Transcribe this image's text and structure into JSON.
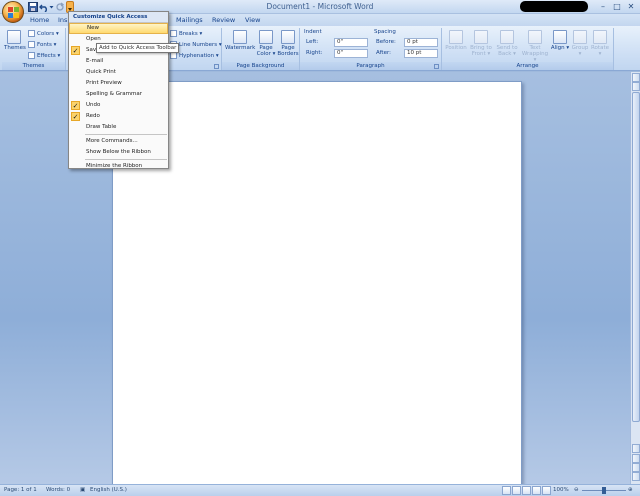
{
  "window": {
    "title": "Document1 - Microsoft Word",
    "minimize": "–",
    "maximize": "□",
    "close": "✕"
  },
  "tabs": [
    {
      "label": "Home"
    },
    {
      "label": "Ins"
    },
    {
      "label": "Mailings"
    },
    {
      "label": "Review"
    },
    {
      "label": "View"
    }
  ],
  "ribbon": {
    "themes": {
      "themes_label": "Themes",
      "colors": "Colors ▾",
      "fonts": "Fonts ▾",
      "effects": "Effects ▾",
      "group_label": "Themes"
    },
    "page_setup": {
      "breaks": "Breaks ▾",
      "line_numbers": "Line Numbers ▾",
      "hyphenation": "Hyphenation ▾"
    },
    "page_background": {
      "watermark": "Watermark",
      "page_color": "Page Color ▾",
      "page_borders": "Page Borders",
      "group_label": "Page Background"
    },
    "paragraph": {
      "indent_label": "Indent",
      "left_label": "Left:",
      "left_value": "0\"",
      "right_label": "Right:",
      "right_value": "0\"",
      "spacing_label": "Spacing",
      "before_label": "Before:",
      "before_value": "0 pt",
      "after_label": "After:",
      "after_value": "10 pt",
      "group_label": "Paragraph"
    },
    "arrange": {
      "position": "Position",
      "bring_to_front": "Bring to Front ▾",
      "send_to_back": "Send to Back ▾",
      "text_wrapping": "Text Wrapping ▾",
      "align": "Align ▾",
      "group": "Group ▾",
      "rotate": "Rotate ▾",
      "group_label": "Arrange"
    }
  },
  "qat_menu": {
    "header": "Customize Quick Access Toolbar",
    "items": [
      {
        "label": "New",
        "checked": false
      },
      {
        "label": "Open",
        "checked": false
      },
      {
        "label": "Save",
        "checked": true
      },
      {
        "label": "E-mail",
        "checked": false
      },
      {
        "label": "Quick Print",
        "checked": false
      },
      {
        "label": "Print Preview",
        "checked": false
      },
      {
        "label": "Spelling & Grammar",
        "checked": false
      },
      {
        "label": "Undo",
        "checked": true
      },
      {
        "label": "Redo",
        "checked": true
      },
      {
        "label": "Draw Table",
        "checked": false
      },
      {
        "label": "More Commands...",
        "checked": false
      },
      {
        "label": "Show Below the Ribbon",
        "checked": false
      },
      {
        "label": "Minimize the Ribbon",
        "checked": false
      }
    ],
    "tooltip": "Add to Quick Access Toolbar"
  },
  "status": {
    "page": "Page: 1 of 1",
    "words": "Words: 0",
    "language": "English (U.S.)",
    "zoom": "100%"
  },
  "colors": {
    "accent": "#15428b",
    "highlight": "#ffd96f"
  }
}
